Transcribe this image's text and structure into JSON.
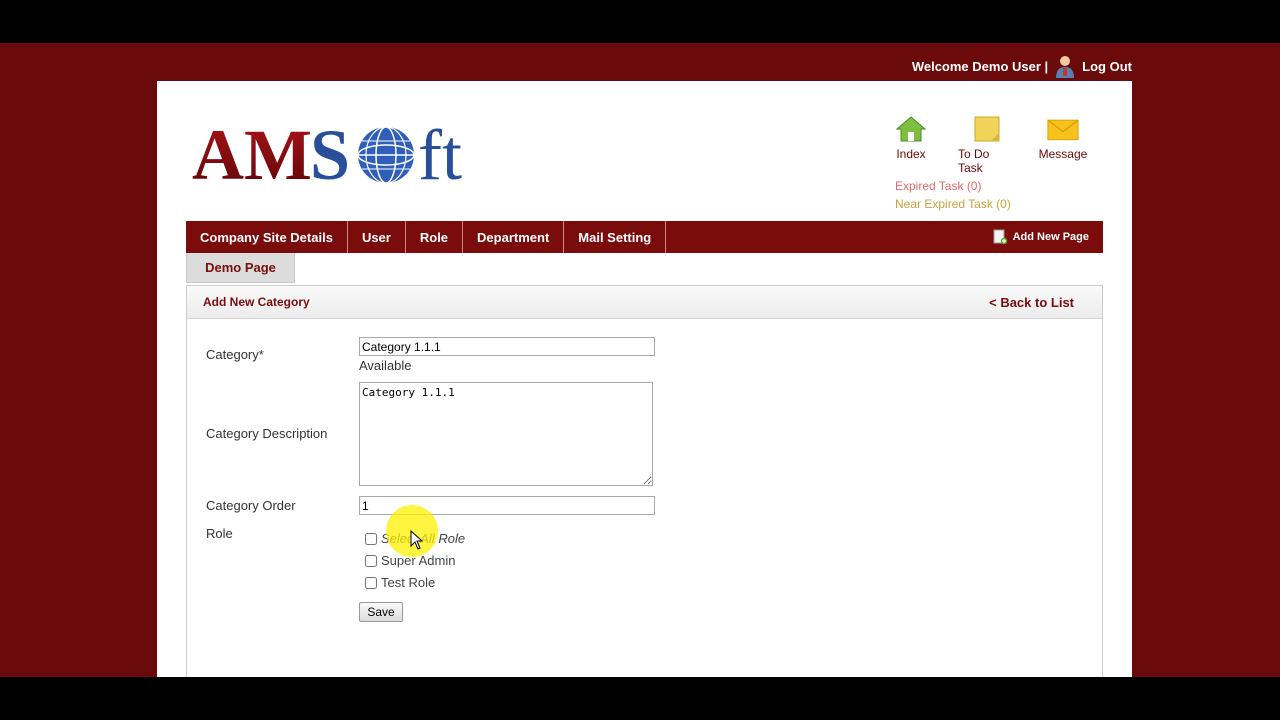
{
  "header": {
    "welcome": "Welcome Demo User |",
    "logout": "Log Out"
  },
  "logo": {
    "text": "AMSoft"
  },
  "quicklinks": [
    {
      "label": "Index",
      "icon": "home-icon"
    },
    {
      "label": "To Do Task",
      "icon": "note-icon"
    },
    {
      "label": "Message",
      "icon": "envelope-icon"
    }
  ],
  "tasks": {
    "expired": "Expired Task (0)",
    "near_expired": "Near Expired Task (0)"
  },
  "menu": {
    "items": [
      "Company Site Details",
      "User",
      "Role",
      "Department",
      "Mail Setting"
    ],
    "add_new_page": "Add New Page"
  },
  "subtab": {
    "label": "Demo Page"
  },
  "form": {
    "title": "Add New Category",
    "back_link": "< Back to List",
    "category_label": "Category*",
    "category_value": "Category 1.1.1",
    "availability": "Available",
    "description_label": "Category Description",
    "description_value": "Category 1.1.1",
    "order_label": "Category Order",
    "order_value": "1",
    "role_label": "Role",
    "roles": [
      {
        "label": "Select All Role",
        "checked": false
      },
      {
        "label": "Super Admin",
        "checked": false
      },
      {
        "label": "Test Role",
        "checked": false
      }
    ],
    "save_label": "Save"
  },
  "colors": {
    "brand": "#7a0c0c",
    "page_background": "#6b0a0a",
    "expired": "#e06a6a",
    "near_expired": "#c9a23d"
  }
}
